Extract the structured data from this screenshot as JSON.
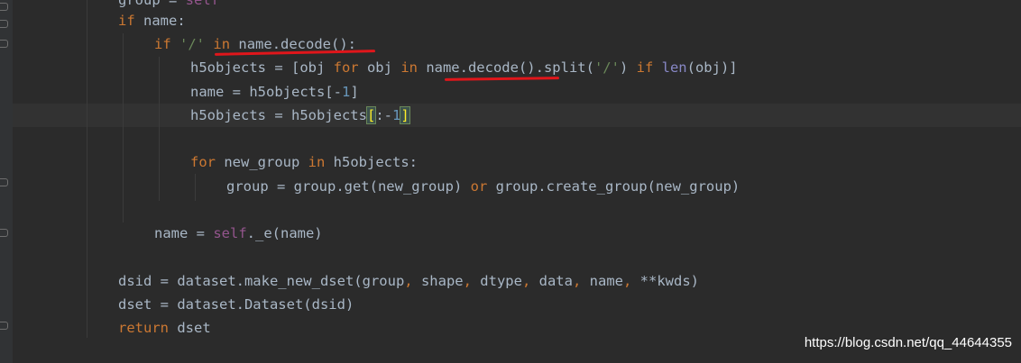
{
  "code_lines": [
    [
      "group",
      " = ",
      "self"
    ],
    [
      "if",
      " name:"
    ],
    [
      "if",
      " ",
      "'/'",
      " ",
      "in",
      " name.decode():"
    ],
    [
      "h5objects = [obj ",
      "for",
      " obj ",
      "in",
      " name.decode().split(",
      "'/'",
      ") ",
      "if",
      " ",
      "len",
      "(obj)]"
    ],
    [
      "name = h5objects[-",
      "1",
      "]"
    ],
    [
      "h5objects = h5objects",
      "[",
      ":-",
      "1",
      "]"
    ],
    [],
    [
      "for",
      " new_group ",
      "in",
      " h5objects:"
    ],
    [
      "group = group.get(new_group) ",
      "or",
      " group.create_group(new_group)"
    ],
    [],
    [
      "name = ",
      "self",
      "._e(name)"
    ],
    [],
    [
      "dsid = dataset.make_new_dset(group",
      ",",
      " shape",
      ",",
      " dtype",
      ",",
      " data",
      ",",
      " name",
      ",",
      " **kwds)"
    ],
    [
      "dset = dataset.Dataset(dsid)"
    ],
    [
      "return",
      " dset"
    ]
  ],
  "colors": {
    "background": "#2b2b2b",
    "keyword": "#cc7832",
    "string": "#6a8759",
    "number": "#6897bb",
    "self": "#94558d",
    "builtin": "#8888c6",
    "plain": "#a9b7c6",
    "annotation_underline": "#e0161b"
  },
  "watermark": "https://blog.csdn.net/qq_44644355"
}
